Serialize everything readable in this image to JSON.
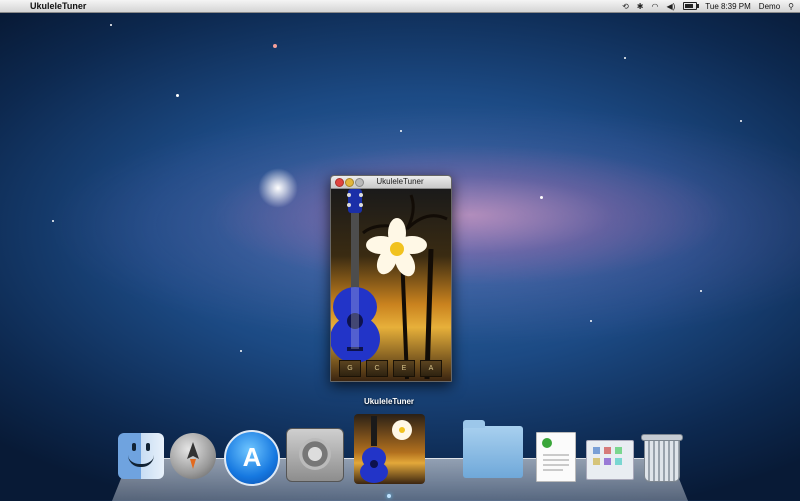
{
  "menubar": {
    "app_name": "UkuleleTuner",
    "time": "Tue 8:39 PM",
    "user": "Demo",
    "icons": [
      "apple-icon",
      "time-machine-icon",
      "bluetooth-icon",
      "wifi-icon",
      "volume-icon",
      "battery-icon",
      "spotlight-icon"
    ]
  },
  "window": {
    "title": "UkuleleTuner",
    "string_buttons": [
      "G",
      "C",
      "E",
      "A"
    ]
  },
  "dock": {
    "tooltip": "UkuleleTuner",
    "items": [
      "Finder",
      "Launchpad",
      "App Store",
      "System Preferences",
      "UkuleleTuner",
      "Documents",
      "TextEdit",
      "Applications",
      "Trash"
    ]
  }
}
